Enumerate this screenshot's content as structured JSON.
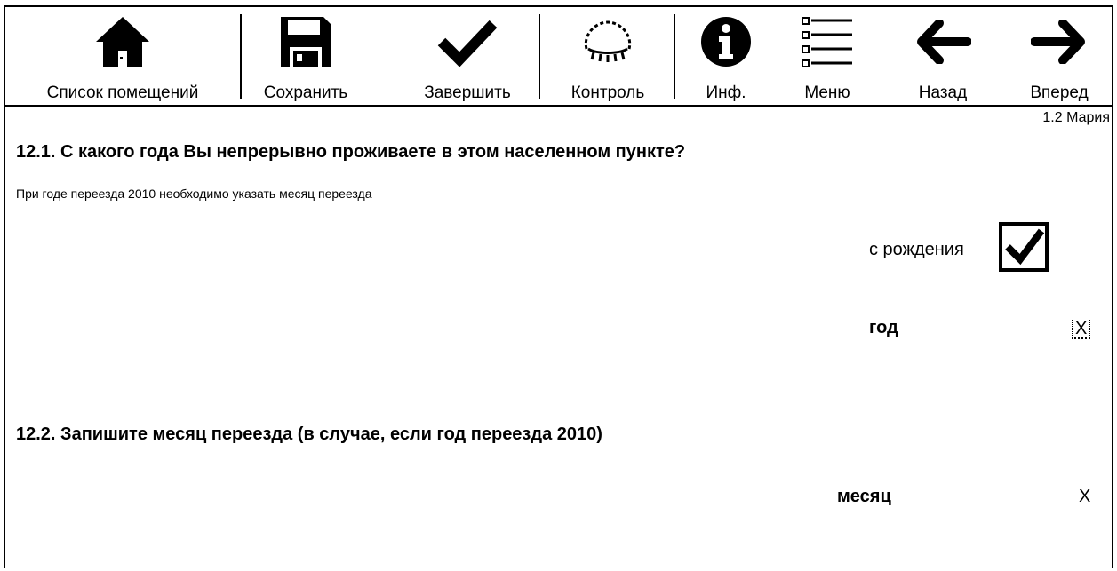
{
  "toolbar": {
    "rooms_label": "Список помещений",
    "save_label": "Сохранить",
    "finish_label": "Завершить",
    "control_label": "Контроль",
    "info_label": "Инф.",
    "menu_label": "Меню",
    "back_label": "Назад",
    "forward_label": "Вперед"
  },
  "page_info": "1.2 Мария",
  "q1": {
    "title": "12.1. С какого года Вы непрерывно проживаете в этом населенном пункте?",
    "hint": "При годе переезда 2010 необходимо указать месяц переезда",
    "since_birth_label": "с рождения",
    "since_birth_checked": true,
    "year_label": "год",
    "year_value": "X"
  },
  "q2": {
    "title": "12.2. Запишите месяц переезда (в случае, если год переезда 2010)",
    "month_label": "месяц",
    "month_value": "X"
  },
  "icons": {
    "rooms": "home-icon",
    "save": "floppy-disk-icon",
    "finish": "checkmark-icon",
    "control": "control-icon",
    "info": "info-icon",
    "menu": "list-menu-icon",
    "back": "arrow-left-icon",
    "forward": "arrow-right-icon"
  }
}
